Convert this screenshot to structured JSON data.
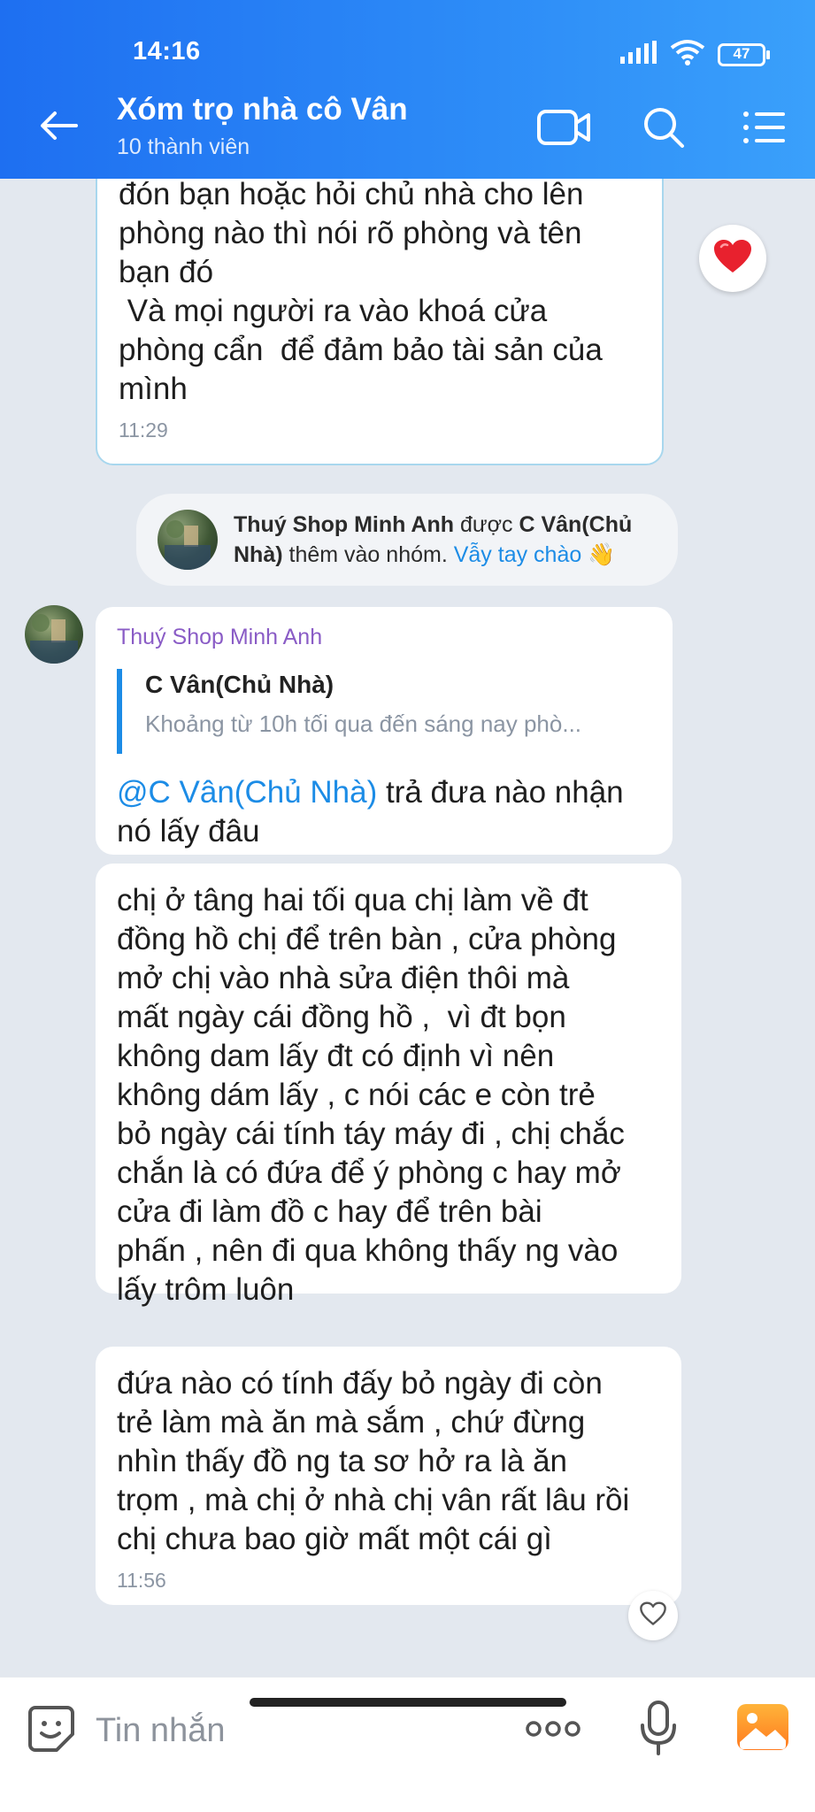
{
  "status_bar": {
    "time": "14:16",
    "battery": "47"
  },
  "header": {
    "title": "Xóm trọ nhà cô Vân",
    "subtitle": "10 thành viên",
    "icons": [
      "back-arrow-icon",
      "video-call-icon",
      "search-icon",
      "menu-list-icon"
    ]
  },
  "messages": {
    "m1": {
      "text": "đón bạn hoặc hỏi chủ nhà cho lên\nphòng nào thì nói rõ phòng và tên\nbạn đó\n Và mọi người ra vào khoá cửa\nphòng cẩn  để đảm bảo tài sản của\nmình",
      "time": "11:29",
      "reaction": "heart"
    },
    "system": {
      "name_bold": "Thuý Shop Minh Anh",
      "text_1": " được ",
      "adder_bold": "C Vân(Chủ Nhà)",
      "text_2": " thêm vào nhóm. ",
      "link": "Vẫy tay chào",
      "emoji": "👋"
    },
    "m2": {
      "sender": "Thuý Shop Minh Anh",
      "quote_name": "C Vân(Chủ Nhà)",
      "quote_text": "Khoảng từ 10h tối qua đến sáng nay phò...",
      "mention": "@C Vân(Chủ Nhà)",
      "text": " trả đưa nào nhận\nnó lấy đâu"
    },
    "m3": {
      "text": "chị ở tâng hai tối qua chị làm về đt\nđồng hồ chị để trên bàn , cửa phòng\nmở chị vào nhà sửa điện thôi mà\nmất ngày cái đồng hồ ,  vì đt bọn\nkhông dam lấy đt có định vì nên\nkhông dám lấy , c nói các e còn trẻ\nbỏ ngày cái tính táy máy đi , chị chắc\nchắn là có đứa để ý phòng c hay mở\ncửa đi làm đồ c hay để trên bài\nphấn , nên đi qua không thấy ng vào\nlấy trôm luôn"
    },
    "m4": {
      "text": "đứa nào có tính đấy bỏ ngày đi còn\ntrẻ làm mà ăn mà sắm , chứ đừng\nnhìn thấy đồ ng ta sơ hở ra là ăn\ntrọm , mà chị ở nhà chị vân rất lâu rồi\nchị chưa bao giờ mất một cái gì",
      "time": "11:56"
    }
  },
  "input": {
    "placeholder": "Tin nhắn",
    "icons": [
      "sticker-icon",
      "more-dots-icon",
      "microphone-icon",
      "gallery-icon"
    ]
  },
  "colors": {
    "header_start": "#1e6ff1",
    "header_end": "#3aa0fb",
    "chat_bg": "#e3e8ef",
    "link": "#1c8ce6",
    "sender": "#8a5cc6",
    "heart": "#e8212e"
  }
}
